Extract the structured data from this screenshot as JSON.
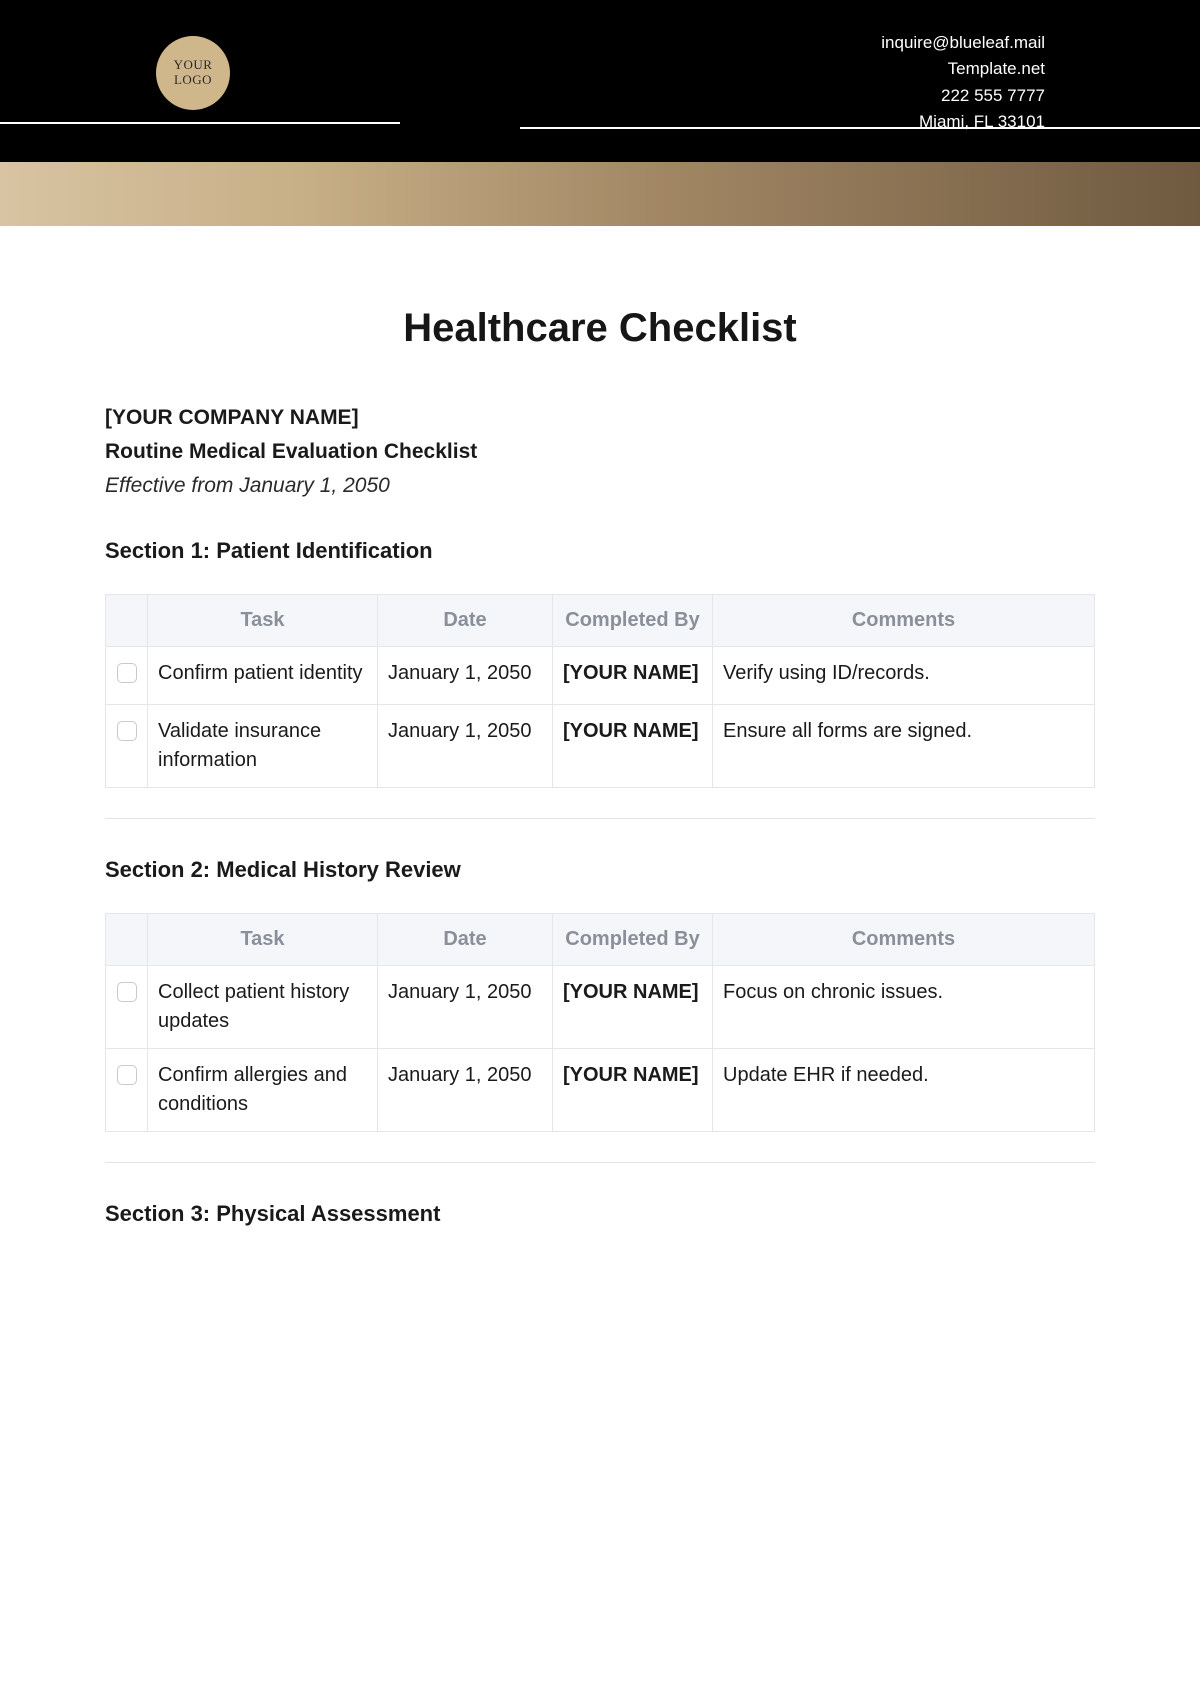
{
  "header": {
    "logo_line1": "YOUR",
    "logo_line2": "LOGO",
    "contact": {
      "email": "inquire@blueleaf.mail",
      "site": "Template.net",
      "phone": "222 555 7777",
      "address": "Miami, FL 33101"
    }
  },
  "title": "Healthcare Checklist",
  "company_placeholder": "[YOUR COMPANY NAME]",
  "subtitle": "Routine Medical Evaluation Checklist",
  "effective": "Effective from January 1, 2050",
  "columns": {
    "task": "Task",
    "date": "Date",
    "by": "Completed By",
    "comments": "Comments"
  },
  "sections": [
    {
      "heading": "Section 1: Patient Identification",
      "rows": [
        {
          "task": "Confirm patient identity",
          "date": "January 1, 2050",
          "by": "[YOUR NAME]",
          "comments": "Verify using ID/records."
        },
        {
          "task": "Validate insurance information",
          "date": "January 1, 2050",
          "by": "[YOUR NAME]",
          "comments": "Ensure all forms are signed."
        }
      ]
    },
    {
      "heading": "Section 2: Medical History Review",
      "rows": [
        {
          "task": "Collect patient history updates",
          "date": "January 1, 2050",
          "by": "[YOUR NAME]",
          "comments": "Focus on chronic issues."
        },
        {
          "task": "Confirm allergies and conditions",
          "date": "January 1, 2050",
          "by": "[YOUR NAME]",
          "comments": "Update EHR if needed."
        }
      ]
    },
    {
      "heading": "Section 3: Physical Assessment",
      "rows": []
    }
  ]
}
